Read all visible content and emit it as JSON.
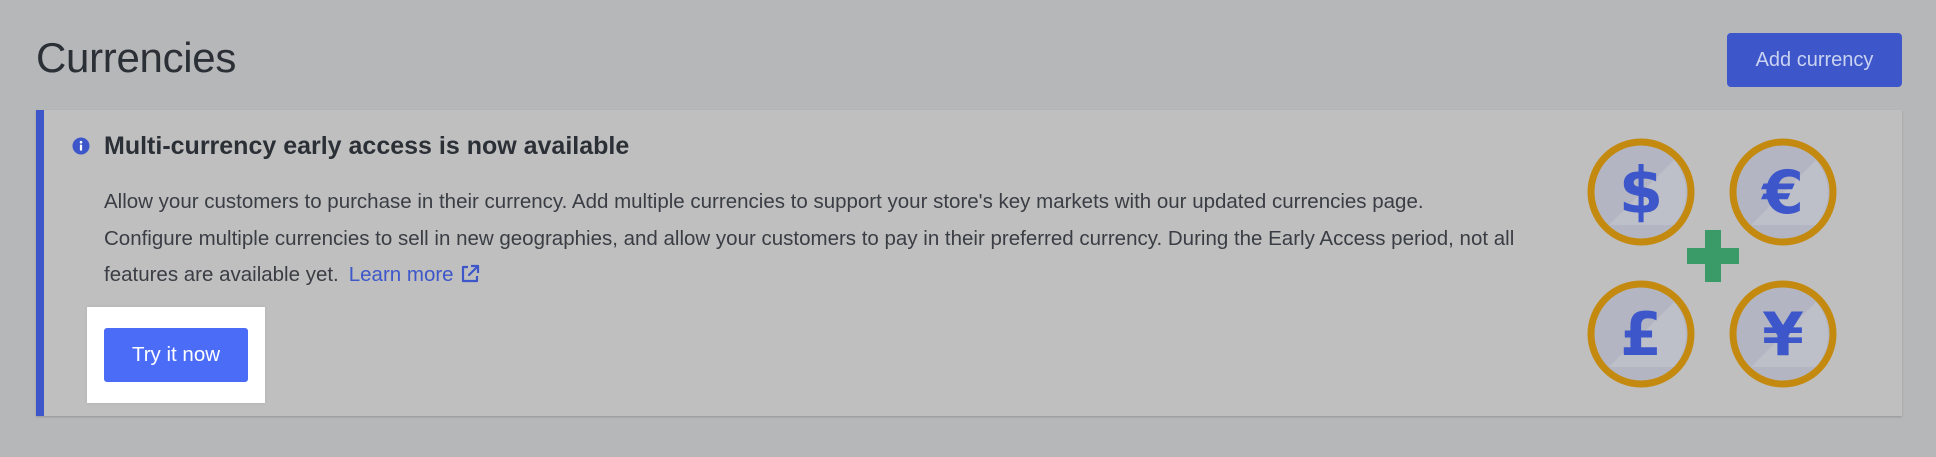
{
  "page": {
    "title": "Currencies"
  },
  "header": {
    "add_currency_label": "Add currency"
  },
  "banner": {
    "title": "Multi-currency early access is now available",
    "body_line1": "Allow your customers to purchase in their currency. Add multiple currencies to support your store's key markets with our updated currencies page.",
    "body_line2": "Configure multiple currencies to sell in new geographies, and allow your customers to pay in their preferred currency. During the Early Access period, not all features are available yet.",
    "learn_more_label": "Learn more",
    "try_label": "Try it now",
    "icons": {
      "info": "info-icon",
      "external_link": "external-link-icon",
      "illustration": [
        "dollar-coin-icon",
        "euro-coin-icon",
        "pound-coin-icon",
        "yen-coin-icon",
        "plus-icon"
      ]
    },
    "illustration_symbols": {
      "dollar": "$",
      "euro": "€",
      "pound": "£",
      "yen": "¥"
    }
  },
  "colors": {
    "background": "#b6b7b9",
    "banner_background": "#bfbfbf",
    "accent": "#3d57cb",
    "primary_button": "#4b6cf7",
    "coin_ring": "#c48a10",
    "coin_face": "#b3b6c2",
    "coin_symbol": "#3d57cb",
    "plus": "#3a9a68"
  }
}
